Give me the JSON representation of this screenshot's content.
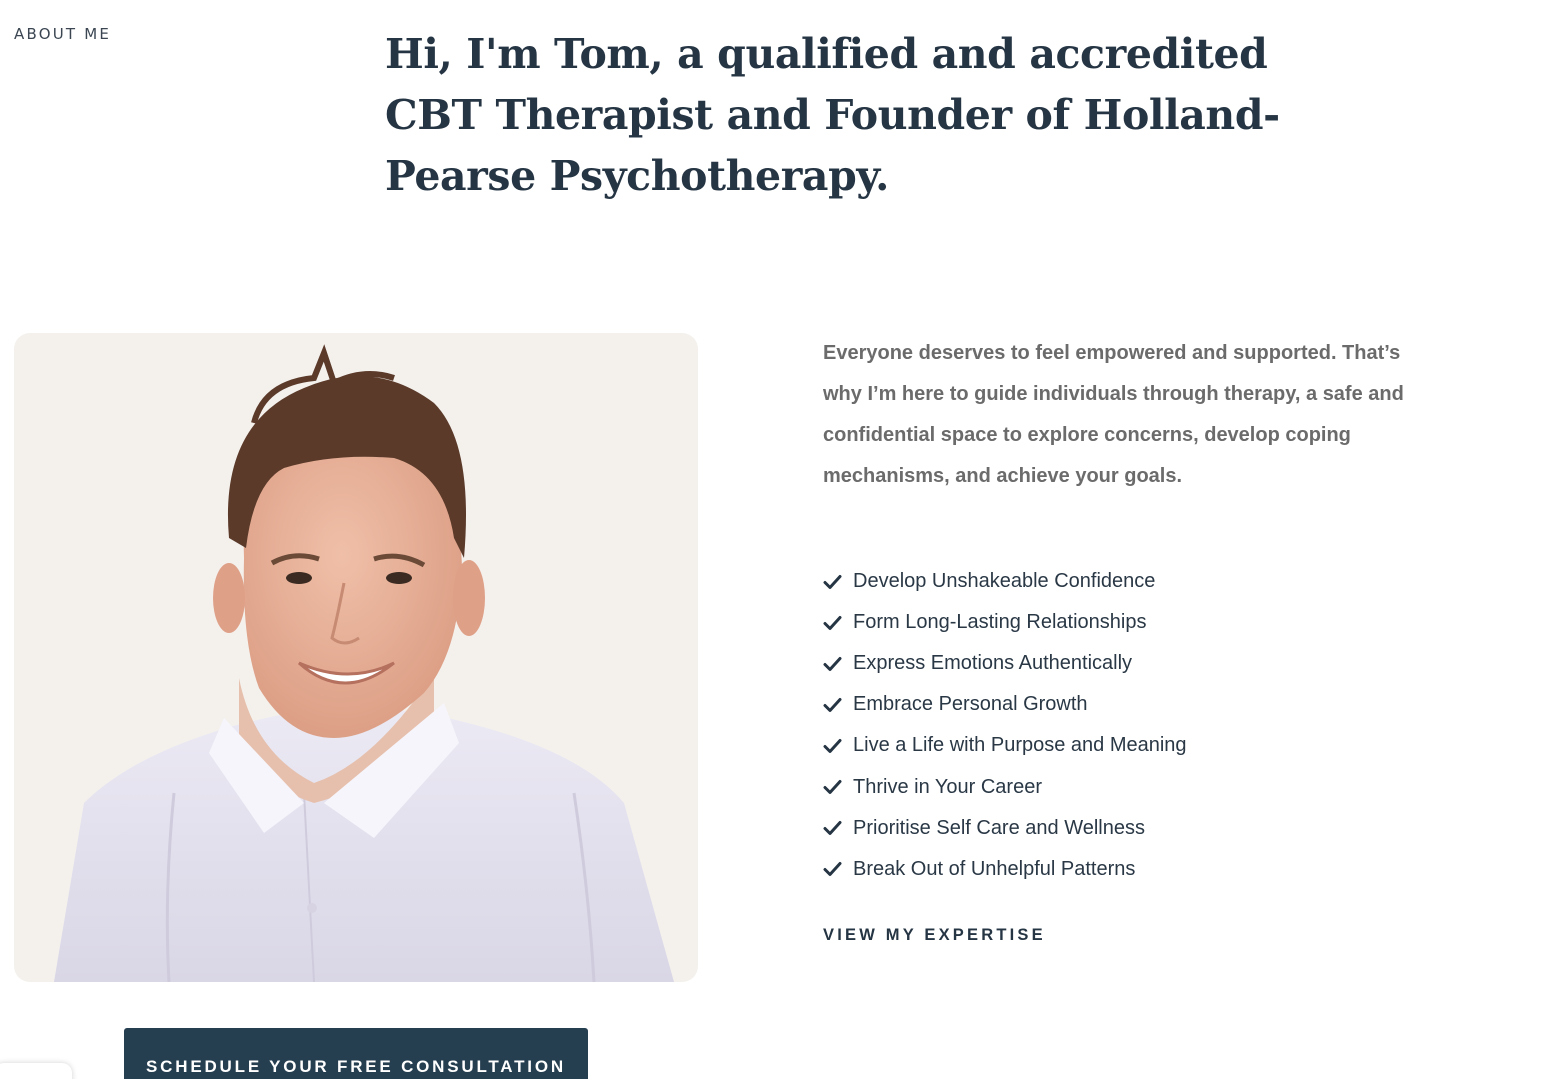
{
  "section": {
    "label": "ABOUT ME"
  },
  "headline": "Hi, I'm Tom, a qualified and accredited CBT Therapist and Founder of Holland-Pearse Psychotherapy.",
  "intro": "Everyone deserves to feel empowered and supported. That’s why I’m here to guide individuals through therapy, a safe and confidential space to explore concerns, develop coping mechanisms, and achieve your goals.",
  "benefits": [
    "Develop Unshakeable Confidence",
    "Form Long-Lasting Relationships",
    "Express Emotions Authentically",
    "Embrace Personal Growth",
    "Live a Life with Purpose and Meaning",
    "Thrive in Your Career",
    "Prioritise Self Care and Wellness",
    "Break Out of Unhelpful Patterns"
  ],
  "expertise_link": "VIEW MY EXPERTISE",
  "cta_button": "SCHEDULE YOUR FREE CONSULTATION",
  "icons": {
    "list_bullet": "check-icon"
  },
  "colors": {
    "heading": "#263544",
    "body_text": "#6b6b6b",
    "button_bg": "#263f50",
    "photo_bg": "#f4f1ed"
  }
}
